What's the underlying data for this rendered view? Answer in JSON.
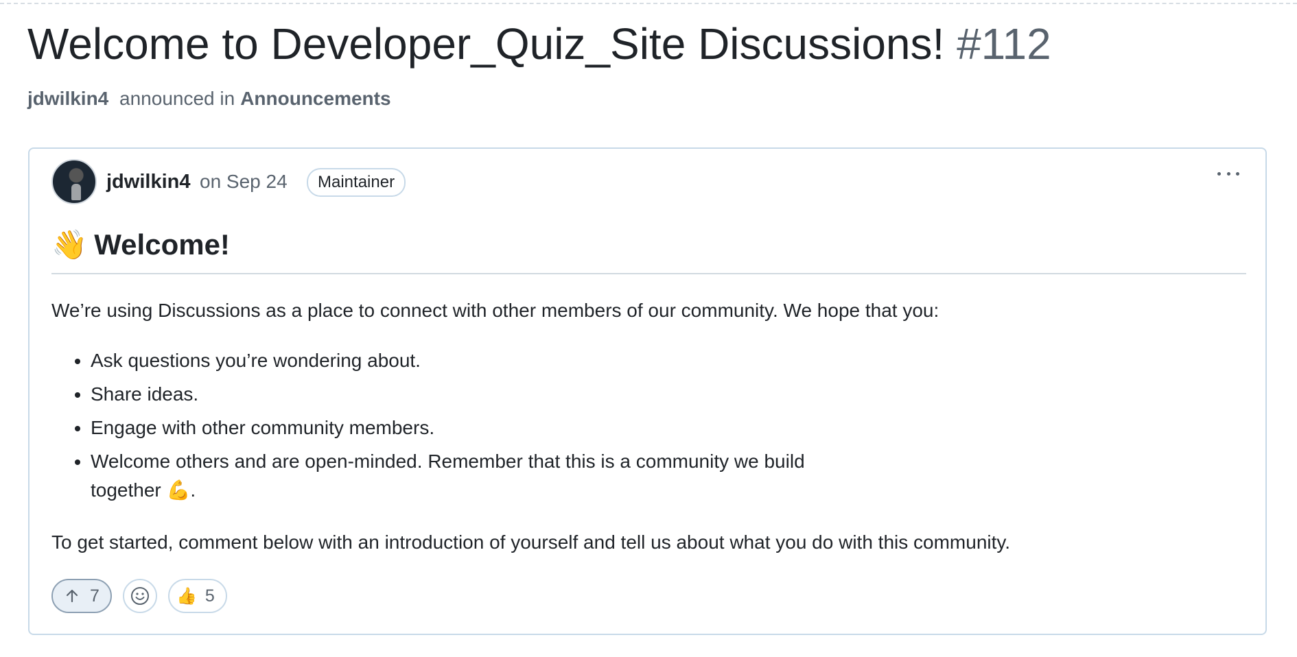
{
  "discussion": {
    "title": "Welcome to Developer_Quiz_Site Discussions!",
    "number": "#112",
    "meta": {
      "author": "jdwilkin4",
      "action": "announced in",
      "category": "Announcements"
    }
  },
  "post": {
    "author": "jdwilkin4",
    "date": "on Sep 24",
    "role_badge": "Maintainer",
    "menu_icon": "kebab-horizontal-icon",
    "heading_emoji": "👋",
    "heading": "Welcome!",
    "intro": "We’re using Discussions as a place to connect with other members of our community. We hope that you:",
    "bullets": [
      "Ask questions you’re wondering about.",
      "Share ideas.",
      "Engage with other community members.",
      "Welcome others and are open-minded. Remember that this is a community we build together"
    ],
    "bullet4_emoji": "💪",
    "bullet4_end": ".",
    "outro": "To get started, comment below with an introduction of yourself and tell us about what you do with this community.",
    "reactions": {
      "upvote_count": "7",
      "add_reaction_icon": "smiley-icon",
      "thumbs_emoji": "👍",
      "thumbs_count": "5"
    }
  },
  "colors": {
    "text": "#1f2328",
    "muted": "#59636e",
    "border": "#c7d9e8",
    "upvote_bg": "#e8eff6"
  }
}
